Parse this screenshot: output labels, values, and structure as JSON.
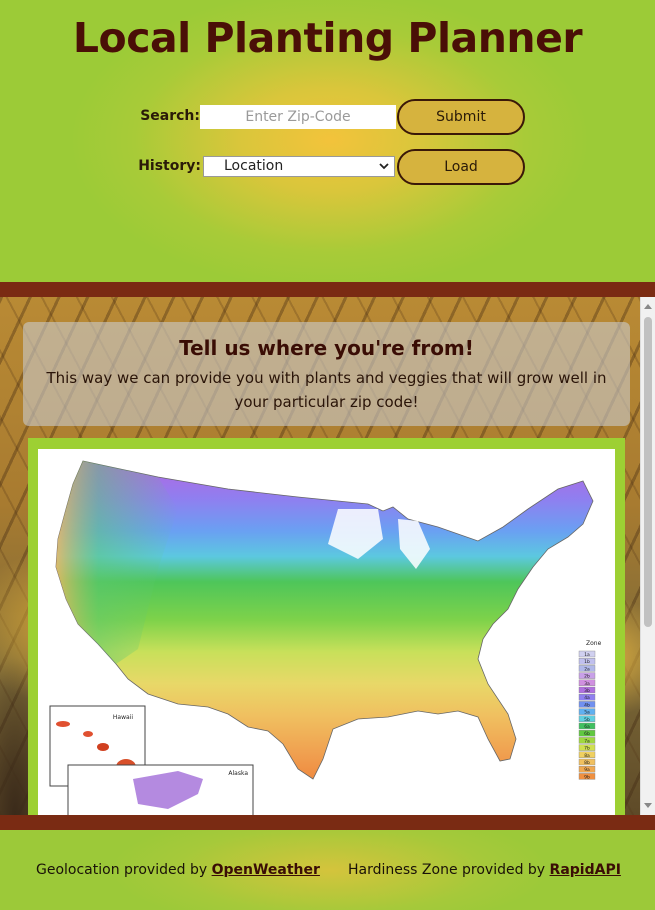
{
  "header": {
    "title": "Local Planting Planner",
    "search_label": "Search:",
    "search_placeholder": "Enter Zip-Code",
    "submit_label": "Submit",
    "history_label": "History:",
    "history_selected": "Location",
    "load_label": "Load"
  },
  "intro": {
    "heading": "Tell us where you're from!",
    "text": "This way we can provide you with plants and veggies that will grow well in your particular zip code!"
  },
  "map": {
    "inset_hawaii": "Hawaii",
    "inset_alaska": "Alaska",
    "legend_title": "Zone",
    "zones": [
      "1a",
      "1b",
      "2a",
      "2b",
      "3a",
      "3b",
      "4a",
      "4b",
      "5a",
      "5b",
      "6a",
      "6b",
      "7a",
      "7b",
      "8a",
      "8b",
      "9a",
      "9b"
    ]
  },
  "footer": {
    "geo_prefix": "Geolocation provided by",
    "geo_link": "OpenWeather",
    "zone_prefix": "Hardiness Zone provided by",
    "zone_link": "RapidAPI"
  },
  "colors": {
    "title": "#4a0f07",
    "band": "#7a2b13",
    "button": "#d6b33e",
    "header_green": "#9ccb37",
    "header_gold": "#f3c33b"
  }
}
